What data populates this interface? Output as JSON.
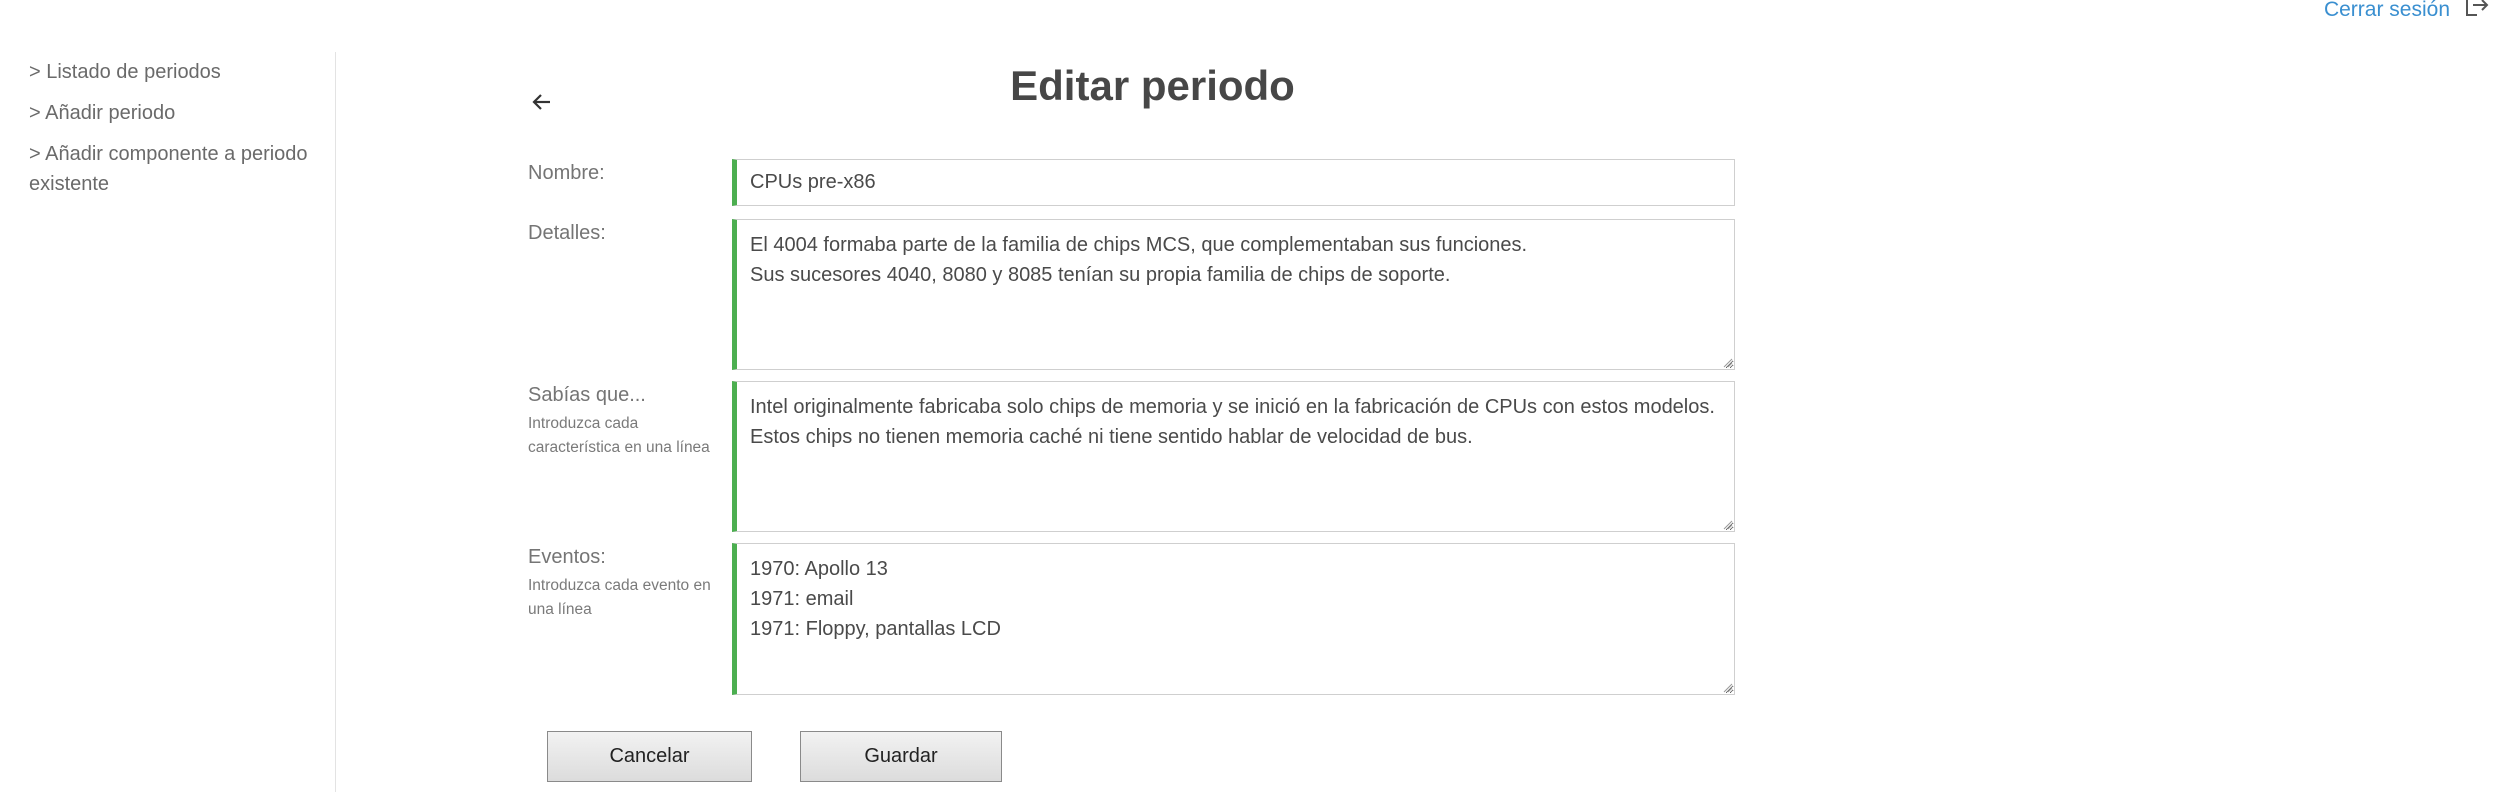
{
  "header": {
    "logout_label": "Cerrar sesión",
    "logout_icon": "logout-icon"
  },
  "sidebar": {
    "items": [
      {
        "label": "> Listado de periodos"
      },
      {
        "label": "> Añadir periodo"
      },
      {
        "label": "> Añadir componente a periodo existente"
      }
    ]
  },
  "main": {
    "back_icon": "arrow-left-icon",
    "title": "Editar periodo",
    "fields": {
      "nombre": {
        "label": "Nombre:",
        "value": "CPUs pre-x86"
      },
      "detalles": {
        "label": "Detalles:",
        "value": "El 4004 formaba parte de la familia de chips MCS, que complementaban sus funciones.\nSus sucesores 4040, 8080 y 8085 tenían su propia familia de chips de soporte."
      },
      "sabias": {
        "label": "Sabías que...",
        "hint": "Introduzca cada característica en una línea",
        "value": "Intel originalmente fabricaba solo chips de memoria y se inició en la fabricación de CPUs con estos modelos.\nEstos chips no tienen memoria caché ni tiene sentido hablar de velocidad de bus."
      },
      "eventos": {
        "label": "Eventos:",
        "hint": "Introduzca cada evento en una línea",
        "value": "1970: Apollo 13\n1971: email\n1971: Floppy, pantallas LCD"
      }
    },
    "buttons": {
      "cancel_label": "Cancelar",
      "save_label": "Guardar"
    }
  },
  "colors": {
    "accent_border": "#4caf50",
    "link": "#3a8fd0"
  }
}
